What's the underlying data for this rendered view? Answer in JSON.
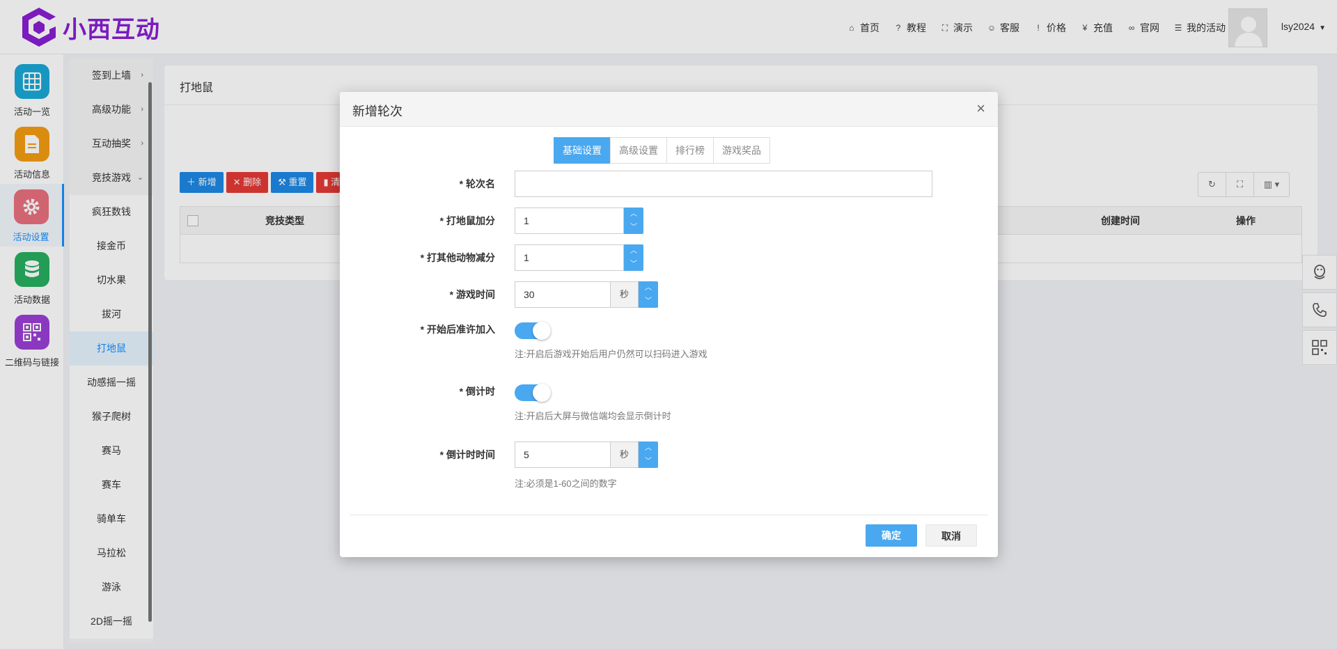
{
  "brand": {
    "name": "小西互动",
    "color": "#8a1fd4"
  },
  "topnav": [
    {
      "label": "首页",
      "icon": "home-icon",
      "glyph": "⌂"
    },
    {
      "label": "教程",
      "icon": "question-circle-icon",
      "glyph": "?"
    },
    {
      "label": "演示",
      "icon": "expand-icon",
      "glyph": "⛶"
    },
    {
      "label": "客服",
      "icon": "smile-icon",
      "glyph": "☺"
    },
    {
      "label": "价格",
      "icon": "info-icon",
      "glyph": "!"
    },
    {
      "label": "充值",
      "icon": "yen-icon",
      "glyph": "¥"
    },
    {
      "label": "官网",
      "icon": "link-icon",
      "glyph": "∞"
    },
    {
      "label": "我的活动",
      "icon": "list-icon",
      "glyph": "☰"
    }
  ],
  "user": {
    "name": "lsy2024"
  },
  "iconbar": [
    {
      "label": "活动一览",
      "color": "#1aa7d6"
    },
    {
      "label": "活动信息",
      "color": "#f39c12"
    },
    {
      "label": "活动设置",
      "color": "#e8707e"
    },
    {
      "label": "活动数据",
      "color": "#27ae60"
    },
    {
      "label": "二维码与链接",
      "color": "#9b3fd6"
    }
  ],
  "submenu": {
    "parents": [
      "签到上墙",
      "高级功能",
      "互动抽奖",
      "竞技游戏"
    ],
    "children": [
      "疯狂数钱",
      "接金币",
      "切水果",
      "拔河",
      "打地鼠",
      "动感摇一摇",
      "猴子爬树",
      "赛马",
      "赛车",
      "骑单车",
      "马拉松",
      "游泳",
      "2D摇一摇"
    ]
  },
  "content": {
    "title": "打地鼠",
    "toolbar": {
      "add": "新增",
      "delete": "删除",
      "reset": "重置",
      "clear": "清"
    },
    "columns": [
      "竞技类型",
      "创建时间",
      "操作"
    ]
  },
  "modal": {
    "title": "新增轮次",
    "tabs": [
      "基础设置",
      "高级设置",
      "排行榜",
      "游戏奖品"
    ],
    "fields": {
      "round_name": {
        "label": "* 轮次名",
        "value": ""
      },
      "hit_score": {
        "label": "* 打地鼠加分",
        "value": "1"
      },
      "miss_score": {
        "label": "* 打其他动物减分",
        "value": "1"
      },
      "game_time": {
        "label": "* 游戏时间",
        "value": "30",
        "unit": "秒"
      },
      "allow_join": {
        "label": "* 开始后准许加入",
        "on": true,
        "note": "注:开启后游戏开始后用户仍然可以扫码进入游戏"
      },
      "countdown": {
        "label": "* 倒计时",
        "on": true,
        "note": "注:开启后大屏与微信端均会显示倒计时"
      },
      "countdown_time": {
        "label": "* 倒计时时间",
        "value": "5",
        "unit": "秒",
        "note": "注:必须是1-60之间的数字"
      }
    },
    "ok": "确定",
    "cancel": "取消"
  },
  "accent_color": "#4aa8f0"
}
